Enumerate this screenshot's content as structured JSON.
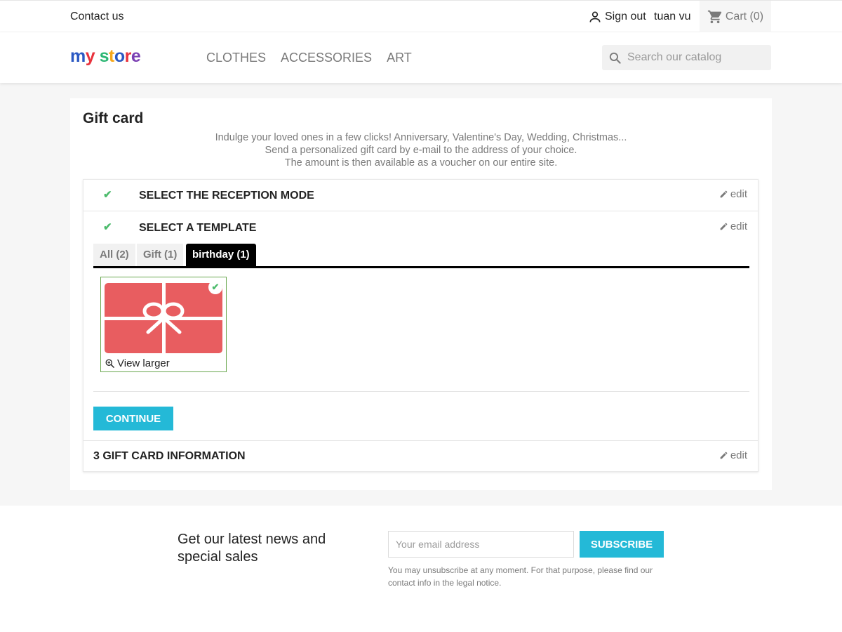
{
  "topbar": {
    "contact": "Contact us",
    "sign_out": "Sign out",
    "username": "tuan vu",
    "cart": "Cart (0)"
  },
  "header": {
    "logo": {
      "letters": [
        {
          "char": "m",
          "color": "#2b59c3"
        },
        {
          "char": "y",
          "color": "#e8323c"
        },
        {
          "char": " ",
          "color": "#ffffff"
        },
        {
          "char": "s",
          "color": "#2bb673"
        },
        {
          "char": "t",
          "color": "#f7a81b"
        },
        {
          "char": "o",
          "color": "#2b59c3"
        },
        {
          "char": "r",
          "color": "#e8323c"
        },
        {
          "char": "e",
          "color": "#7b3fb3"
        }
      ]
    },
    "nav": [
      "CLOTHES",
      "ACCESSORIES",
      "ART"
    ],
    "search_placeholder": "Search our catalog"
  },
  "main": {
    "title": "Gift card",
    "intro": [
      "Indulge your loved ones in a few clicks! Anniversary, Valentine's Day, Wedding, Christmas...",
      "Send a personalized gift card by e-mail to the address of your choice.",
      "The amount is then available as a voucher on our entire site."
    ],
    "steps": {
      "step1_title": "SELECT THE RECEPTION MODE",
      "step2_title": "SELECT A TEMPLATE",
      "step3_title": "3 GIFT CARD INFORMATION",
      "edit_label": "edit"
    },
    "tabs": [
      {
        "label": "All (2)",
        "active": false
      },
      {
        "label": "Gift (1)",
        "active": false
      },
      {
        "label": "birthday (1)",
        "active": true
      }
    ],
    "template": {
      "view_larger": "View larger"
    },
    "continue_label": "CONTINUE"
  },
  "newsletter": {
    "title": "Get our latest news and special sales",
    "email_placeholder": "Your email address",
    "subscribe_label": "SUBSCRIBE",
    "note": "You may unsubscribe at any moment. For that purpose, please find our contact info in the legal notice."
  },
  "colors": {
    "accent": "#24b9d7",
    "check": "#4cbb6c",
    "gift_card": "#e85d60"
  }
}
